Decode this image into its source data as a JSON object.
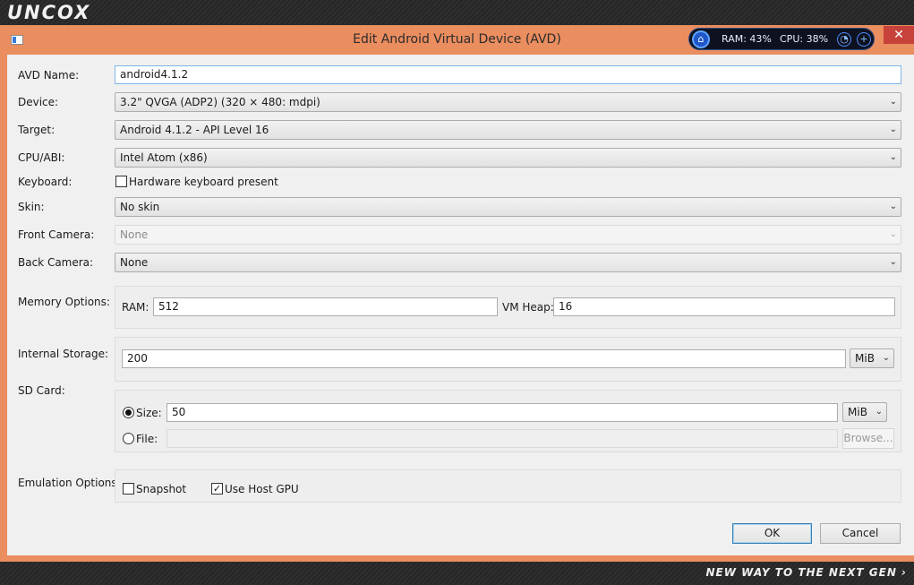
{
  "watermark": {
    "logo": "UNCOX",
    "tagline": "NEW WAY TO THE NEXT GEN ›"
  },
  "window": {
    "title": "Edit Android Virtual Device (AVD)",
    "close": "✕"
  },
  "monitor": {
    "ram": "RAM: 43%",
    "cpu": "CPU: 38%",
    "icon": "broom-icon",
    "btn1": "gauge-icon",
    "btn2": "plus-icon"
  },
  "form": {
    "avd_name": {
      "label": "AVD Name:",
      "value": "android4.1.2"
    },
    "device": {
      "label": "Device:",
      "value": "3.2\" QVGA (ADP2) (320 × 480: mdpi)"
    },
    "target": {
      "label": "Target:",
      "value": "Android 4.1.2 - API Level 16"
    },
    "cpu": {
      "label": "CPU/ABI:",
      "value": "Intel Atom (x86)"
    },
    "keyboard": {
      "label": "Keyboard:",
      "checkbox_label": "Hardware keyboard present",
      "checked": false
    },
    "skin": {
      "label": "Skin:",
      "value": "No skin"
    },
    "front_camera": {
      "label": "Front Camera:",
      "value": "None",
      "disabled": true
    },
    "back_camera": {
      "label": "Back Camera:",
      "value": "None"
    },
    "memory": {
      "label": "Memory Options:",
      "ram_label": "RAM:",
      "ram_value": "512",
      "heap_label": "VM Heap:",
      "heap_value": "16"
    },
    "internal_storage": {
      "label": "Internal Storage:",
      "value": "200",
      "unit": "MiB"
    },
    "sd_card": {
      "label": "SD Card:",
      "size_label": "Size:",
      "size_value": "50",
      "size_unit": "MiB",
      "size_selected": true,
      "file_label": "File:",
      "file_value": "",
      "browse": "Browse..."
    },
    "emulation": {
      "label": "Emulation Options:",
      "snapshot": "Snapshot",
      "snapshot_checked": false,
      "host_gpu": "Use Host GPU",
      "host_gpu_checked": true
    }
  },
  "buttons": {
    "ok": "OK",
    "cancel": "Cancel"
  },
  "colors": {
    "titlebar": "#ea8d5f",
    "close": "#c7423b",
    "client": "#f0f0f0"
  }
}
